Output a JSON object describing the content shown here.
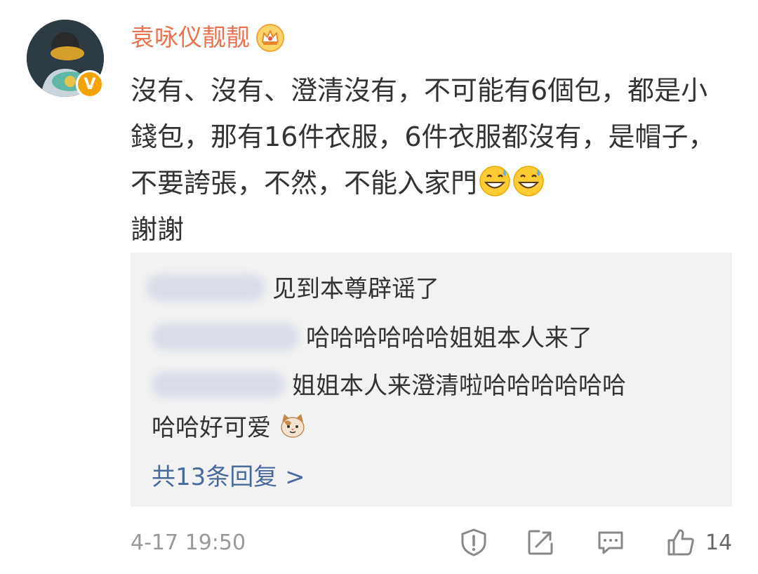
{
  "post": {
    "username": "袁咏仪靓靓",
    "badge_icon": "crown-icon",
    "verified_mark": "V",
    "content_text": "沒有、沒有、澄清沒有，不可能有6個包，都是小錢包，那有16件衣服，6件衣服都沒有，是帽子，不要誇張，不然，不能入家門",
    "content_tail": "謝謝",
    "content_emojis": [
      "grinning-sweat-emoji",
      "grinning-sweat-emoji"
    ],
    "timestamp": "4-17 19:50",
    "like_count": "14"
  },
  "replies": [
    {
      "author_blurred": true,
      "text": "见到本尊辟谣了"
    },
    {
      "author_blurred": true,
      "text": "哈哈哈哈哈哈姐姐本人来了"
    },
    {
      "author_blurred": true,
      "text": "姐姐本人来澄清啦哈哈哈哈哈哈",
      "text_cont": "哈哈好可爱",
      "emoji": "cat-face-emoji"
    }
  ],
  "more_replies_label": "共13条回复 >",
  "actions": [
    "report-icon",
    "share-icon",
    "comment-icon",
    "like-icon"
  ],
  "colors": {
    "username": "#eb7350",
    "link": "#4a6a9c",
    "reply_bg": "#f2f2f2",
    "meta": "#999999"
  }
}
